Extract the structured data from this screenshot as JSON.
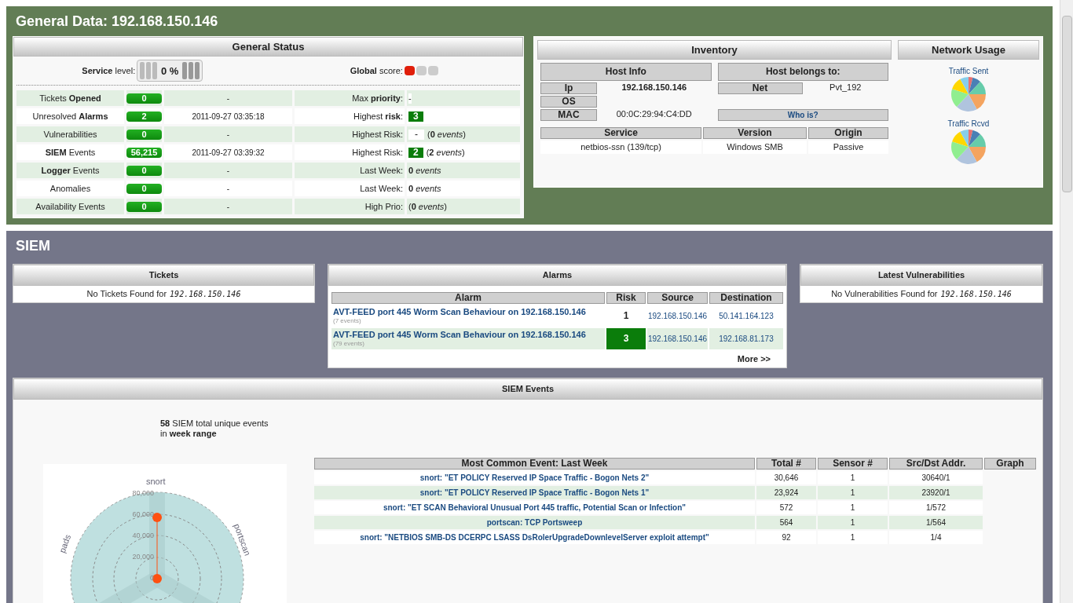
{
  "general": {
    "title": "General Data: 192.168.150.146",
    "status": {
      "title": "General Status",
      "service_label": "**Service** level:",
      "service_value": "0 %",
      "global_label": "**Global** score:",
      "score_dots": [
        {
          "color": "#e01e0a"
        },
        {
          "color": "#cccccc"
        },
        {
          "color": "#cccccc"
        }
      ],
      "rows": [
        {
          "label": "Tickets **Opened**",
          "count": "0",
          "date": "-",
          "right_label": "Max **priority**:",
          "kind": "plain",
          "right_value": "-"
        },
        {
          "label": "Unresolved **Alarms**",
          "count": "2",
          "date": "2011-09-27 03:35:18",
          "right_label": "Highest **risk**:",
          "kind": "risk",
          "right_value": "3"
        },
        {
          "label": "Vulnerabilities",
          "count": "0",
          "date": "-",
          "right_label": "Highest Risk:",
          "kind": "blank",
          "right_value": "-",
          "right_note": "(**0** *events*)"
        },
        {
          "label": "**SIEM** Events",
          "count": "56,215",
          "date": "2011-09-27 03:39:32",
          "right_label": "Highest Risk:",
          "kind": "risk",
          "right_value": "2",
          "right_note": "(**2** *events*)"
        },
        {
          "label": "**Logger** Events",
          "count": "0",
          "date": "-",
          "right_label": "Last Week:",
          "kind": "note",
          "right_note": "**0** *events*"
        },
        {
          "label": "Anomalies",
          "count": "0",
          "date": "-",
          "right_label": "Last Week:",
          "kind": "note",
          "right_note": "**0** *events*"
        },
        {
          "label": "Availability Events",
          "count": "0",
          "date": "-",
          "right_label": "High Prio:",
          "kind": "note",
          "right_note": "(**0** *events*)"
        }
      ]
    },
    "inventory": {
      "title": "Inventory",
      "host_info": "Host Info",
      "belongs": "Host belongs to:",
      "fields": [
        {
          "label": "Ip",
          "value": "192.168.150.146"
        },
        {
          "label": "OS"
        },
        {
          "label": "MAC",
          "value": "00:0C:29:94:C4:DD"
        }
      ],
      "net_label": "Net",
      "net_value": "Pvt_192",
      "whois": "Who is?",
      "service_columns": [
        "Service",
        "Version",
        "Origin"
      ],
      "services": [
        [
          "netbios-ssn (139/tcp)",
          "Windows SMB",
          "Passive"
        ]
      ]
    },
    "network": {
      "title": "Network Usage",
      "pies": [
        "Traffic Sent",
        "Traffic Rcvd"
      ]
    }
  },
  "siem": {
    "title": "SIEM",
    "tickets": {
      "title": "Tickets",
      "empty": "No Tickets Found for",
      "ip": "192.168.150.146"
    },
    "alarms": {
      "title": "Alarms",
      "columns": [
        "Alarm",
        "Risk",
        "Source",
        "Destination"
      ],
      "rows": [
        {
          "alarm": "AVT-FEED port 445 Worm Scan Behaviour on 192.168.150.146",
          "events": "(7 events)",
          "risk": "1",
          "high": false,
          "source": "192.168.150.146",
          "destination": "50.141.164.123"
        },
        {
          "alarm": "AVT-FEED port 445 Worm Scan Behaviour on 192.168.150.146",
          "events": "(79 events)",
          "risk": "3",
          "high": true,
          "source": "192.168.150.146",
          "destination": "192.168.81.173"
        }
      ],
      "more": "More >>"
    },
    "vulns": {
      "title": "Latest Vulnerabilities",
      "empty": "No Vulnerabilities Found for",
      "ip": "192.168.150.146"
    },
    "events": {
      "title": "SIEM Events",
      "summary1": "**58** SIEM total unique events",
      "summary2": "in **week range**",
      "radar": {
        "axes": [
          "snort",
          "portscan",
          "pads"
        ],
        "ticks": [
          "80,000",
          "60,000",
          "40,000",
          "20,000",
          "0"
        ]
      },
      "columns": [
        "Most Common Event: Last Week",
        "Total #",
        "Sensor #",
        "Src/Dst Addr.",
        "Graph"
      ],
      "rows": [
        [
          "snort: \"ET POLICY Reserved IP Space Traffic - Bogon Nets 2\"",
          "30,646",
          "1",
          "30640/1"
        ],
        [
          "snort: \"ET POLICY Reserved IP Space Traffic - Bogon Nets 1\"",
          "23,924",
          "1",
          "23920/1"
        ],
        [
          "snort: \"ET SCAN Behavioral Unusual Port 445 traffic, Potential Scan or Infection\"",
          "572",
          "1",
          "1/572"
        ],
        [
          "portscan: TCP Portsweep",
          "564",
          "1",
          "1/564"
        ],
        [
          "snort: \"NETBIOS SMB-DS DCERPC LSASS DsRolerUpgradeDownlevelServer exploit attempt\"",
          "92",
          "1",
          "1/4"
        ]
      ]
    }
  }
}
